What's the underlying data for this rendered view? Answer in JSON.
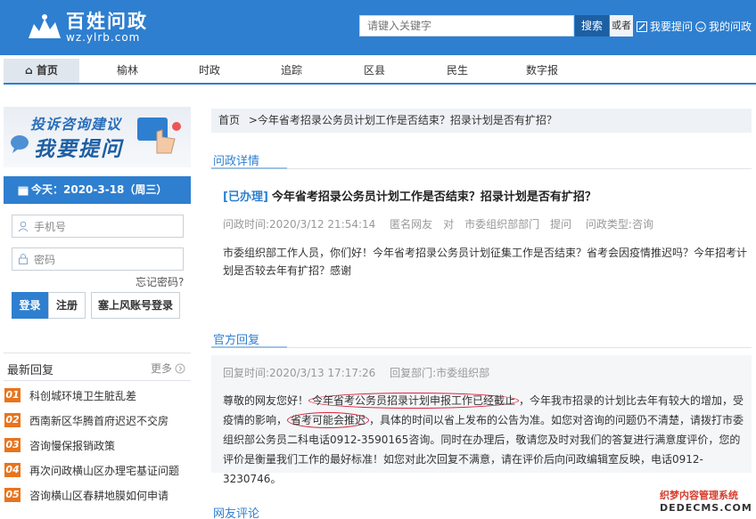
{
  "header": {
    "logo_title": "百姓问政",
    "logo_sub": "wz.ylrb.com",
    "search_placeholder": "请键入关键字",
    "search_label": "搜索",
    "or_label": "或者",
    "ask_label": "我要提问",
    "my_label": "我的问政"
  },
  "nav": [
    "首页",
    "榆林",
    "时政",
    "追踪",
    "区县",
    "民生",
    "数字报"
  ],
  "banner": {
    "line1": "投诉咨询建议",
    "line2": "我要提问"
  },
  "date_text": "今天：2020-3-18（周三）",
  "login": {
    "phone_placeholder": "手机号",
    "password_placeholder": "密码",
    "forgot": "忘记密码?",
    "login_label": "登录",
    "register_label": "注册",
    "wechat_label": "塞上风账号登录"
  },
  "latest": {
    "title": "最新回复",
    "more": "更多",
    "items": [
      {
        "num": "01",
        "text": "科创城环境卫生脏乱差"
      },
      {
        "num": "02",
        "text": "西南新区华腾首府迟迟不交房"
      },
      {
        "num": "03",
        "text": "咨询慢保报销政策"
      },
      {
        "num": "04",
        "text": "再次问政横山区办理宅基证问题"
      },
      {
        "num": "05",
        "text": "咨询横山区春耕地膜如何申请"
      }
    ]
  },
  "breadcrumb": {
    "home": "首页",
    "sep": ">",
    "current": "今年省考招录公务员计划工作是否结束？招录计划是否有扩招？"
  },
  "detail": {
    "section_title": "问政详情",
    "tag": "[已办理]",
    "title": "今年省考招录公务员计划工作是否结束？招录计划是否有扩招？",
    "meta": "问政时间:2020/3/12 21:54:14　 匿名网友　对　市委组织部部门　提问　 问政类型:咨询",
    "body": "市委组织部工作人员，你们好！今年省考招录公务员计划征集工作是否结束？省考会因疫情推迟吗？今年招考计划是否较去年有扩招？感谢"
  },
  "reply": {
    "section_title": "官方回复",
    "meta": "回复时间:2020/3/13 17:17:26　 回复部门:市委组织部",
    "p1": "尊敬的网友您好！",
    "c1": "今年省考公务员招录计划申报工作已经截止",
    "p2": "，今年我市招录的计划比去年有较大的增加，受疫情的影响，",
    "c2": "省考可能会推迟",
    "p3": "，具体的时间以省上发布的公告为准。如您对咨询的问题仍不清楚，请拨打市委组织部公务员二科电话0912-3590165咨询。同时在办理后，敬请您及时对我们的答复进行满意度评价，您的评价是衡量我们工作的最好标准！如您对此次回复不满意，请在评价后向问政编辑室反映，电话0912-3230746。"
  },
  "comments": {
    "section_title": "网友评论"
  },
  "watermark": {
    "line1": "织梦内容管理系统",
    "line2": "DEDECMS.COM"
  }
}
